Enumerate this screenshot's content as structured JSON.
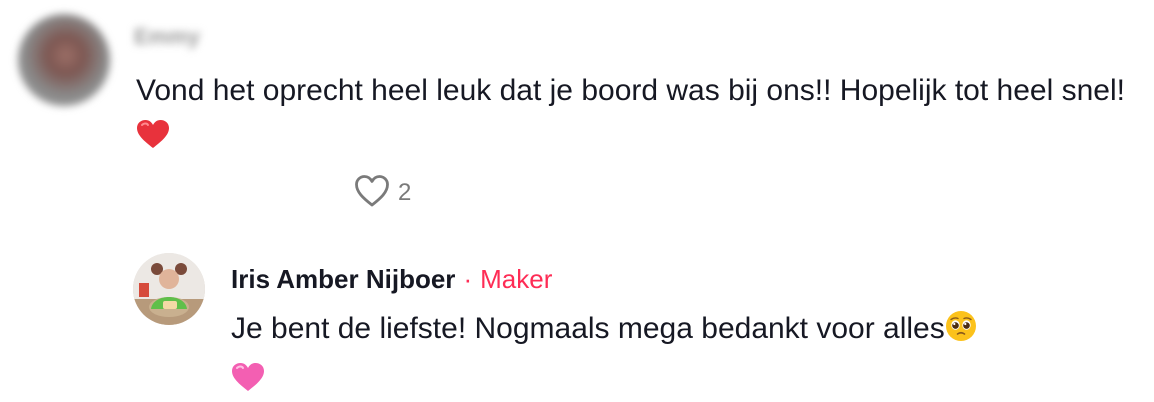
{
  "top_comment": {
    "username": "Emmy",
    "text": "Vond het oprecht heel leuk dat je boord was bij ons!! Hopelijk tot heel snel!",
    "trailing_emoji": "red-heart",
    "like_count": "2",
    "icons": {
      "like": "heart-outline-icon"
    },
    "colors": {
      "text": "#161823",
      "like_count": "#7a7a7a"
    }
  },
  "reply": {
    "author_name": "Iris Amber Nijboer",
    "separator": "·",
    "author_badge": "Maker",
    "text": "Je bent de liefste! Nogmaals mega bedankt voor alles",
    "emojis": [
      "pleading-face",
      "pink-heart"
    ],
    "colors": {
      "badge": "#fe2c55",
      "text": "#161823"
    }
  }
}
